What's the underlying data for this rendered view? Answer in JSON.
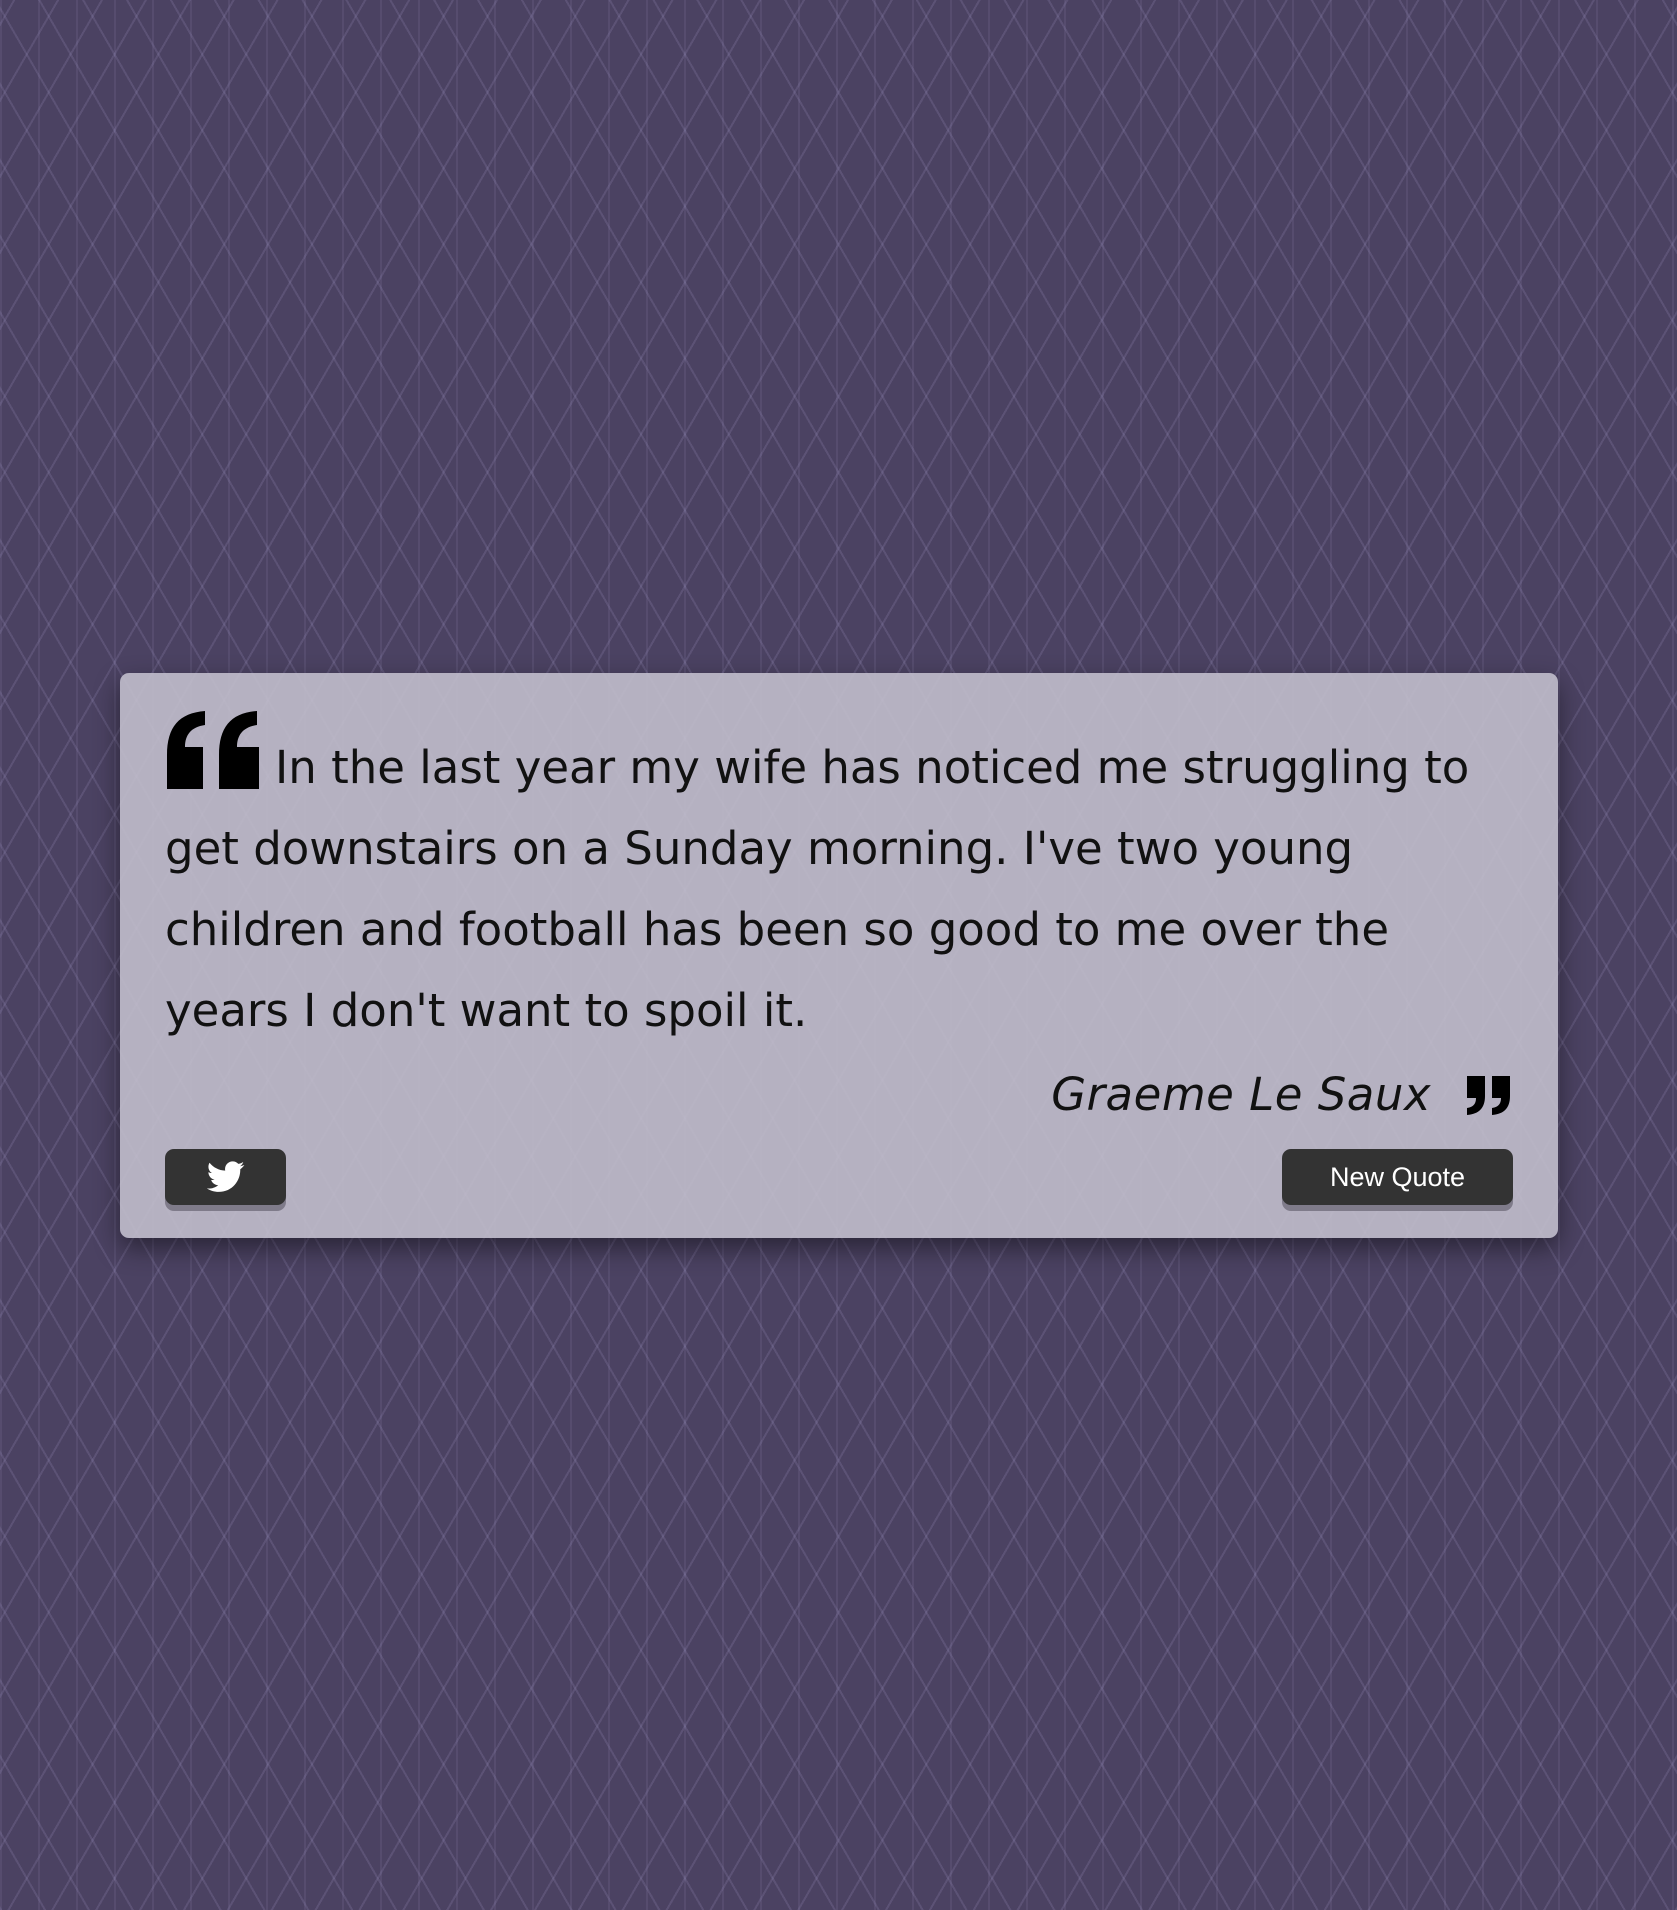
{
  "quote": {
    "text": "In the last year my wife has noticed me struggling to get downstairs on a Sunday morning. I've two young children and football has been so good to me over the years I don't want to spoil it.",
    "author": "Graeme Le Saux",
    "open_icon": "quote-left-icon",
    "close_icon": "quote-right-icon"
  },
  "actions": {
    "tweet_icon": "twitter-icon",
    "new_quote_label": "New Quote"
  },
  "colors": {
    "background": "#4b4262",
    "card": "#c4c0ce",
    "button": "#333333",
    "text": "#111111"
  }
}
